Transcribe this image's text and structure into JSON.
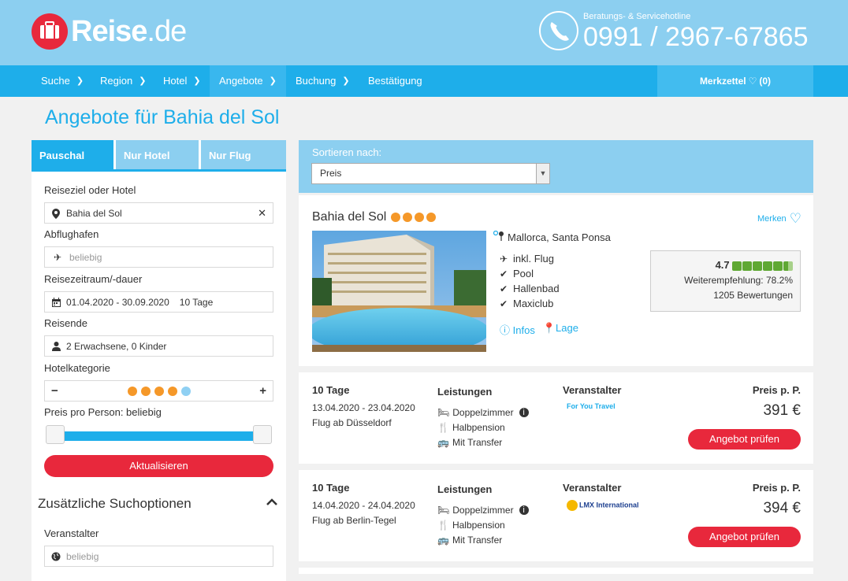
{
  "brand": {
    "name": "Reise",
    "domain": ".de"
  },
  "hotline": {
    "label": "Beratungs- & Servicehotline",
    "number": "0991 / 2967-67865"
  },
  "nav": {
    "items": [
      "Suche",
      "Region",
      "Hotel",
      "Angebote",
      "Buchung",
      "Bestätigung"
    ],
    "merkzettel": "Merkzettel",
    "merkzettel_count": "(0)"
  },
  "page_title": "Angebote für Bahia del Sol",
  "search": {
    "tabs": [
      "Pauschal",
      "Nur Hotel",
      "Nur Flug"
    ],
    "destination_label": "Reiseziel oder Hotel",
    "destination_value": "Bahia del Sol",
    "airport_label": "Abflughafen",
    "airport_placeholder": "beliebig",
    "period_label": "Reisezeitraum/-dauer",
    "period_value": "01.04.2020 - 30.09.2020",
    "duration_value": "10 Tage",
    "travelers_label": "Reisende",
    "travelers_value": "2 Erwachsene, 0 Kinder",
    "category_label": "Hotelkategorie",
    "category_minus": "−",
    "category_plus": "+",
    "category_stars": 4,
    "category_max": 5,
    "price_label": "Preis pro Person: beliebig",
    "update_button": "Aktualisieren",
    "extra_options_title": "Zusätzliche Suchoptionen",
    "operator_label": "Veranstalter",
    "operator_placeholder": "beliebig"
  },
  "sort": {
    "label": "Sortieren nach:",
    "value": "Preis"
  },
  "hotel": {
    "name": "Bahia del Sol",
    "stars": 4,
    "merken": "Merken",
    "location": "Mallorca, Santa Ponsa",
    "features": [
      "inkl. Flug",
      "Pool",
      "Hallenbad",
      "Maxiclub"
    ],
    "infos_link": "Infos",
    "lage_link": "Lage",
    "rating_score": "4.7",
    "recommendation": "Weiterempfehlung: 78.2%",
    "reviews": "1205 Bewertungen"
  },
  "offers": [
    {
      "days": "10 Tage",
      "dates": "13.04.2020 - 23.04.2020",
      "flight": "Flug ab Düsseldorf",
      "leistungen_title": "Leistungen",
      "room": "Doppelzimmer",
      "board": "Halbpension",
      "transfer": "Mit Transfer",
      "veranstalter_title": "Veranstalter",
      "operator": "For You Travel",
      "price_label": "Preis p. P.",
      "price": "391 €",
      "button": "Angebot prüfen"
    },
    {
      "days": "10 Tage",
      "dates": "14.04.2020 - 24.04.2020",
      "flight": "Flug ab Berlin-Tegel",
      "leistungen_title": "Leistungen",
      "room": "Doppelzimmer",
      "board": "Halbpension",
      "transfer": "Mit Transfer",
      "veranstalter_title": "Veranstalter",
      "operator": "LMX International",
      "price_label": "Preis p. P.",
      "price": "394 €",
      "button": "Angebot prüfen"
    }
  ],
  "colors": {
    "brand_blue": "#1eaeea",
    "header_light": "#8ccff0",
    "accent_red": "#e8283c",
    "star_orange": "#f59829"
  }
}
